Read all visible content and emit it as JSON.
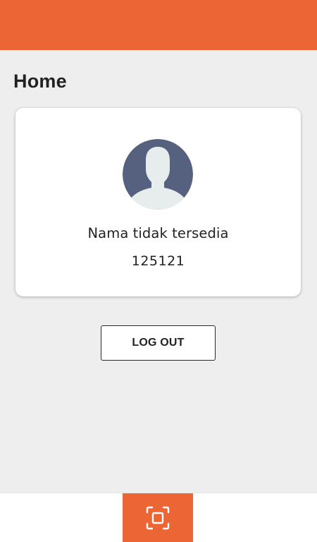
{
  "colors": {
    "accent": "#ec6535",
    "background": "#eeeeee",
    "card": "#ffffff",
    "avatar_bg": "#56617f"
  },
  "header": {
    "title": "Home"
  },
  "profile": {
    "avatar_icon": "user-silhouette-icon",
    "name": "Nama tidak tersedia",
    "id": "125121"
  },
  "actions": {
    "logout_label": "LOG OUT"
  },
  "bottom_nav": {
    "scan_icon": "scan-frame-icon"
  }
}
